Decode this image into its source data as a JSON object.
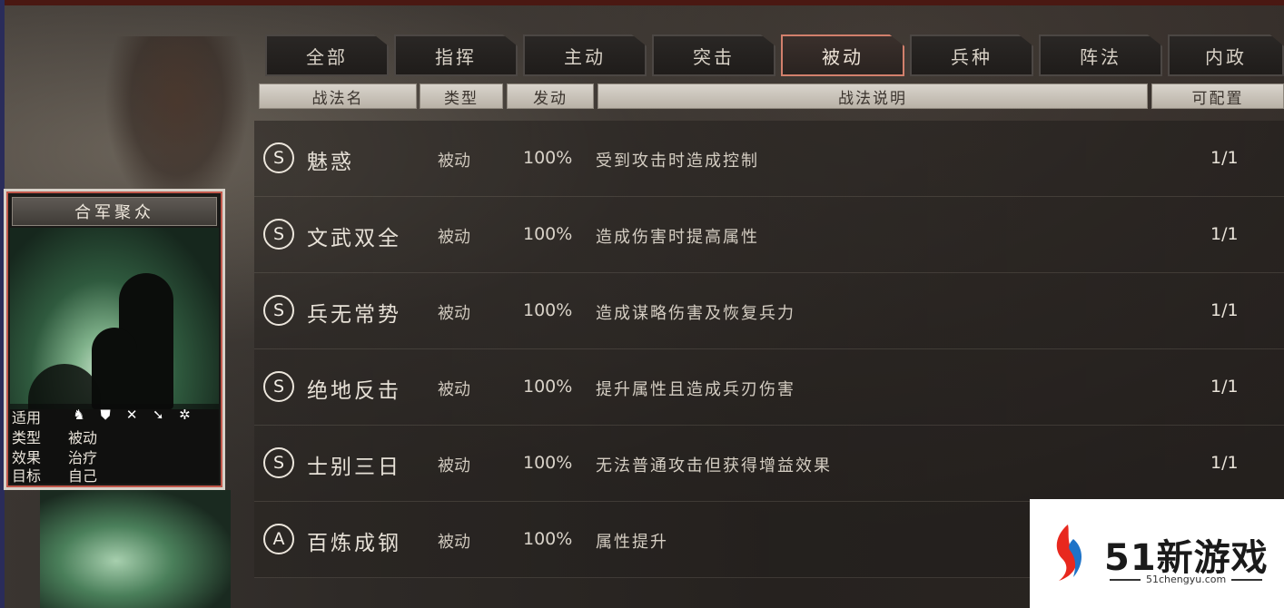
{
  "tabs": [
    "全部",
    "指挥",
    "主动",
    "突击",
    "被动",
    "兵种",
    "阵法",
    "内政"
  ],
  "active_tab": "被动",
  "headers": {
    "name": "战法名",
    "type": "类型",
    "trigger": "发动",
    "desc": "战法说明",
    "config": "可配置"
  },
  "rows": [
    {
      "grade": "S",
      "name": "魅惑",
      "type": "被动",
      "rate": "100%",
      "desc": "受到攻击时造成控制",
      "config": "1/1"
    },
    {
      "grade": "S",
      "name": "文武双全",
      "type": "被动",
      "rate": "100%",
      "desc": "造成伤害时提高属性",
      "config": "1/1"
    },
    {
      "grade": "S",
      "name": "兵无常势",
      "type": "被动",
      "rate": "100%",
      "desc": "造成谋略伤害及恢复兵力",
      "config": "1/1"
    },
    {
      "grade": "S",
      "name": "绝地反击",
      "type": "被动",
      "rate": "100%",
      "desc": "提升属性且造成兵刃伤害",
      "config": "1/1"
    },
    {
      "grade": "S",
      "name": "士别三日",
      "type": "被动",
      "rate": "100%",
      "desc": "无法普通攻击但获得增益效果",
      "config": "1/1"
    },
    {
      "grade": "A",
      "name": "百炼成钢",
      "type": "被动",
      "rate": "100%",
      "desc": "属性提升",
      "config": ""
    }
  ],
  "card": {
    "title": "合军聚众",
    "use_label": "适用",
    "type_label": "类型",
    "type_value": "被动",
    "effect_label": "效果",
    "effect_value": "治疗",
    "target_label": "目标",
    "target_value": "自己",
    "unit_icons": [
      "cavalry-icon",
      "shield-icon",
      "bow-icon",
      "spear-icon",
      "siege-wheel-icon"
    ]
  },
  "watermark": {
    "main": "51新游戏",
    "sub": "51chengyu.com"
  },
  "colors": {
    "active_tab_border": "#d2806c",
    "card_border": "#d7d1c8"
  }
}
